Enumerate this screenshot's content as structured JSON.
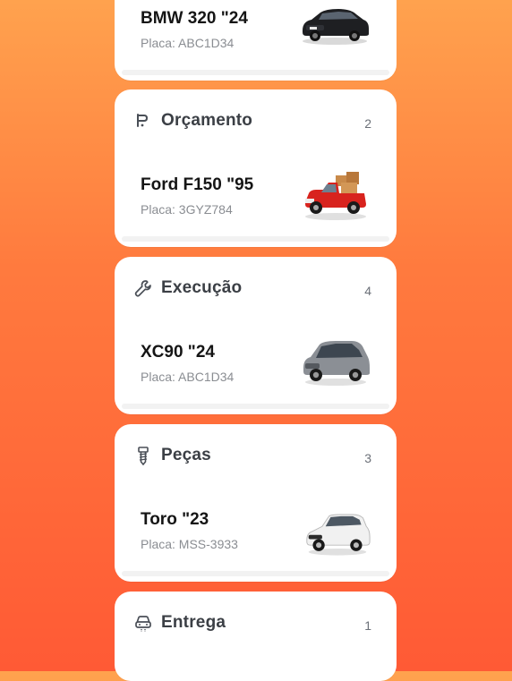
{
  "stages": [
    {
      "title": "",
      "count": "",
      "icon": "",
      "vehicle": {
        "name": "BMW 320 \"24",
        "plate": "Placa: ABC1D34",
        "image": "black-sedan"
      }
    },
    {
      "title": "Orçamento",
      "count": "2",
      "icon": "budget-tag-icon",
      "vehicle": {
        "name": "Ford F150 \"95",
        "plate": "Placa: 3GYZ784",
        "image": "red-pickup-with-boxes"
      }
    },
    {
      "title": "Execução",
      "count": "4",
      "icon": "wrench-icon",
      "vehicle": {
        "name": "XC90 \"24",
        "plate": "Placa: ABC1D34",
        "image": "gray-suv"
      }
    },
    {
      "title": "Peças",
      "count": "3",
      "icon": "screw-icon",
      "vehicle": {
        "name": "Toro \"23",
        "plate": "Placa: MSS-3933",
        "image": "white-pickup"
      }
    },
    {
      "title": "Entrega",
      "count": "1",
      "icon": "car-delivery-icon",
      "vehicle": null
    }
  ],
  "colors": {
    "gradient_top": "#ffa24e",
    "gradient_bottom": "#ff5a35",
    "card": "#ffffff",
    "title": "#3b3f45",
    "plate": "#8a8d92"
  }
}
